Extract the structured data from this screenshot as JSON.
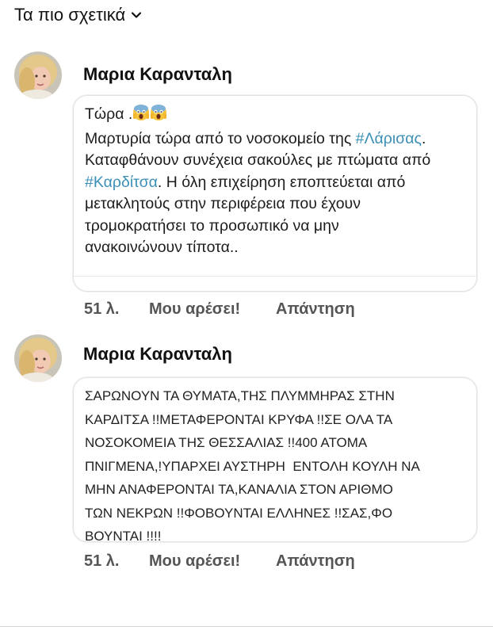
{
  "header": {
    "sort_label": "Τα πιο σχετικά",
    "chevron_icon": "chevron-down-icon"
  },
  "comments": [
    {
      "author": "Μαρια Καρανταλη",
      "avatar_icon": "user-avatar",
      "text": {
        "line1_prefix": "Τώρα .",
        "emojis": [
          "face-screaming-in-fear",
          "face-screaming-in-fear"
        ],
        "line2_a": "Μαρτυρία τώρα από το νοσοκομείο της ",
        "hashtag_1": "#Λάρισας",
        "line2_b": ".",
        "line3": "Καταφθάνουν συνέχεια σακούλες με πτώματα από",
        "hashtag_2": "#Καρδίτσα",
        "line4_b": ". Η όλη επιχείρηση εποπτεύεται από",
        "line5": "μετακλητούς στην περιφέρεια που έχουν",
        "line6": "τρομοκρατήσει το προσωπικό να μην",
        "line7": "ανακοινώνουν τίποτα.."
      },
      "actions": {
        "time": "51 λ.",
        "like": "Μου αρέσει!",
        "reply": "Απάντηση"
      }
    },
    {
      "author": "Μαρια Καρανταλη",
      "avatar_icon": "user-avatar",
      "text_lines": [
        "ΣΑΡΩΝΟΥΝ ΤΑ ΘΥΜΑΤΑ,ΤΗΣ ΠΛΥΜΜΗΡΑΣ ΣΤΗΝ",
        "ΚΑΡΔΙΤΣΑ !!ΜΕΤΑΦΕΡΟΝΤΑΙ ΚΡΥΦΑ !!ΣΕ ΟΛΑ ΤΑ",
        "ΝΟΣΟΚΟΜΕΙΑ ΤΗΣ ΘΕΣΣΑΛΙΑΣ !!400 ΑΤΟΜΑ",
        "ΠΝΙΓΜΕΝΑ,!ΥΠΑΡΧΕΙ ΑΥΣΤΗΡΗ  ΕΝΤΟΛΗ ΚΟΥΛΗ ΝΑ",
        "ΜΗΝ ΑΝΑΦΕΡΟΝΤΑΙ ΤΑ,ΚΑΝΑΛΙΑ ΣΤΟΝ ΑΡΙΘΜΟ",
        "ΤΩΝ ΝΕΚΡΩΝ !!ΦΟΒΟΥΝΤΑΙ ΕΛΛΗΝΕΣ !!ΣΑΣ,ΦΟ",
        "ΒΟΥΝΤΑΙ !!!!"
      ],
      "actions": {
        "time": "51 λ.",
        "like": "Μου αρέσει!",
        "reply": "Απάντηση"
      }
    }
  ]
}
